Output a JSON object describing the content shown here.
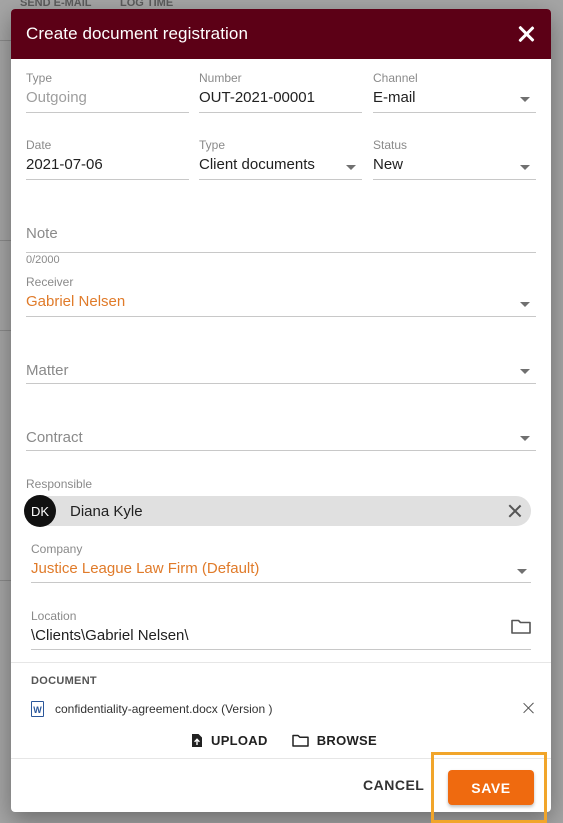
{
  "background": {
    "tab_send_email": "SEND E-MAIL",
    "tab_log_time": "LOG TIME"
  },
  "dialog": {
    "title": "Create document registration",
    "close_icon": "close-icon"
  },
  "fields": {
    "type_direction": {
      "label": "Type",
      "value": "Outgoing"
    },
    "number": {
      "label": "Number",
      "value": "OUT-2021-00001"
    },
    "channel": {
      "label": "Channel",
      "value": "E-mail"
    },
    "date": {
      "label": "Date",
      "value": "2021-07-06"
    },
    "doc_type": {
      "label": "Type",
      "value": "Client documents"
    },
    "status": {
      "label": "Status",
      "value": "New"
    },
    "note": {
      "placeholder": "Note",
      "counter": "0/2000"
    },
    "receiver": {
      "label": "Receiver",
      "value": "Gabriel Nelsen"
    },
    "matter": {
      "placeholder": "Matter"
    },
    "contract": {
      "placeholder": "Contract"
    },
    "responsible": {
      "label": "Responsible",
      "initials": "DK",
      "name": "Diana Kyle"
    },
    "company": {
      "label": "Company",
      "value": "Justice League Law Firm (Default)"
    },
    "location": {
      "label": "Location",
      "value": "\\Clients\\Gabriel Nelsen\\"
    }
  },
  "document": {
    "heading": "DOCUMENT",
    "file_icon_letter": "W",
    "file_name": "confidentiality-agreement.docx (Version )",
    "upload_label": "UPLOAD",
    "browse_label": "BROWSE"
  },
  "footer": {
    "cancel_label": "CANCEL",
    "save_label": "SAVE"
  },
  "colors": {
    "header_bg": "#5c0016",
    "accent_text": "#e07b2a",
    "save_button": "#ef6a0f",
    "highlight": "#f1a52a"
  }
}
